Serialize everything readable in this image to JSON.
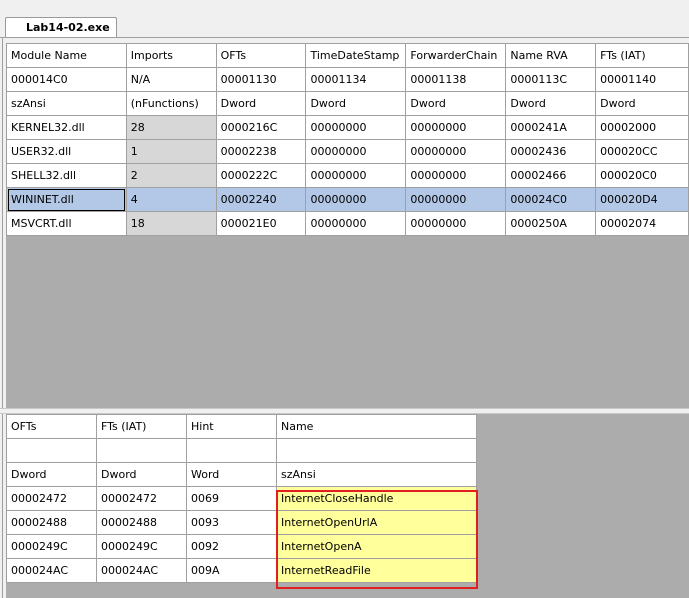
{
  "tab": {
    "label": "Lab14-02.exe"
  },
  "imports_table": {
    "header": [
      "Module Name",
      "Imports",
      "OFTs",
      "TimeDateStamp",
      "ForwarderChain",
      "Name RVA",
      "FTs (IAT)"
    ],
    "offsets": [
      "000014C0",
      "N/A",
      "00001130",
      "00001134",
      "00001138",
      "0000113C",
      "00001140"
    ],
    "types": [
      "szAnsi",
      "(nFunctions)",
      "Dword",
      "Dword",
      "Dword",
      "Dword",
      "Dword"
    ],
    "rows": [
      [
        "KERNEL32.dll",
        "28",
        "0000216C",
        "00000000",
        "00000000",
        "0000241A",
        "00002000"
      ],
      [
        "USER32.dll",
        "1",
        "00002238",
        "00000000",
        "00000000",
        "00002436",
        "000020CC"
      ],
      [
        "SHELL32.dll",
        "2",
        "0000222C",
        "00000000",
        "00000000",
        "00002466",
        "000020C0"
      ],
      [
        "WININET.dll",
        "4",
        "00002240",
        "00000000",
        "00000000",
        "000024C0",
        "000020D4"
      ],
      [
        "MSVCRT.dll",
        "18",
        "000021E0",
        "00000000",
        "00000000",
        "0000250A",
        "00002074"
      ]
    ],
    "selected_row": 3
  },
  "functions_table": {
    "header": [
      "OFTs",
      "FTs (IAT)",
      "Hint",
      "Name"
    ],
    "offsets": [
      "",
      "",
      "",
      ""
    ],
    "types": [
      "Dword",
      "Dword",
      "Word",
      "szAnsi"
    ],
    "rows": [
      [
        "00002472",
        "00002472",
        "0069",
        "InternetCloseHandle"
      ],
      [
        "00002488",
        "00002488",
        "0093",
        "InternetOpenUrlA"
      ],
      [
        "0000249C",
        "0000249C",
        "0092",
        "InternetOpenA"
      ],
      [
        "000024AC",
        "000024AC",
        "009A",
        "InternetReadFile"
      ]
    ]
  },
  "colors": {
    "selection": "#b3c8e6",
    "name_highlight": "#ffff9c",
    "box_outline": "#e02020",
    "pane_background": "#acacac"
  }
}
